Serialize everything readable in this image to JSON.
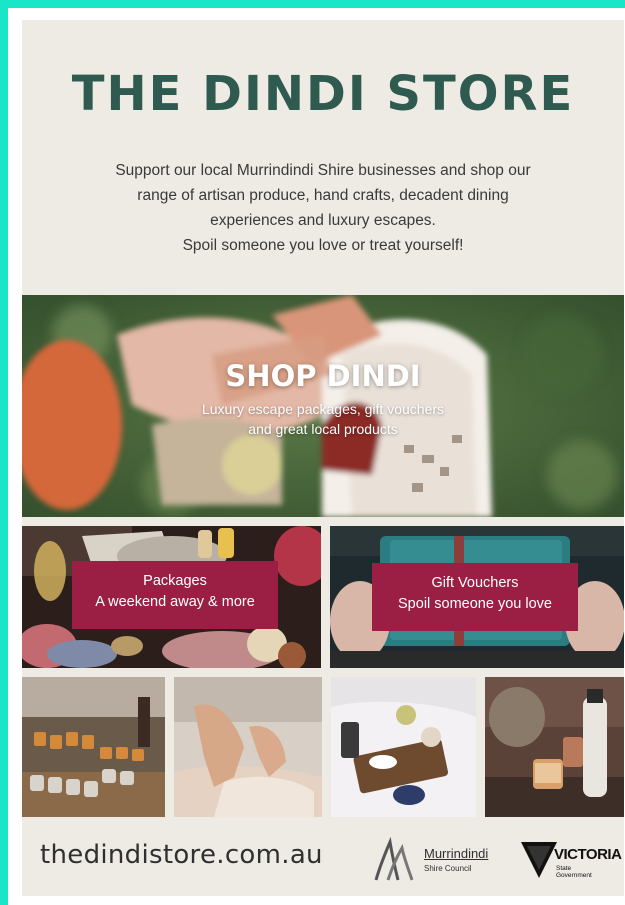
{
  "header": {
    "title": "THE DINDI STORE",
    "intro_lines": [
      "Support our local Murrindindi Shire businesses and shop our",
      "range of artisan produce, hand crafts, decadent dining",
      "experiences and luxury escapes.",
      "Spoil someone you love or treat yourself!"
    ]
  },
  "hero": {
    "title": "SHOP DINDI",
    "subtitle_lines": [
      "Luxury escape packages, gift vouchers",
      "and great local products"
    ]
  },
  "tiles": {
    "packages": {
      "line1": "Packages",
      "line2": "A weekend away & more"
    },
    "vouchers": {
      "line1": "Gift Vouchers",
      "line2": "Spoil someone you love"
    }
  },
  "footer": {
    "url": "thedindistore.com.au",
    "council_name": "Murrindindi",
    "council_sub": "Shire Council",
    "state_name": "VICTORIA",
    "state_sub_line1": "State",
    "state_sub_line2": "Government"
  },
  "colors": {
    "border": "#19e6c8",
    "title": "#2f5a50",
    "label_bg": "#9b1f45",
    "page_bg": "#eeebe4"
  }
}
